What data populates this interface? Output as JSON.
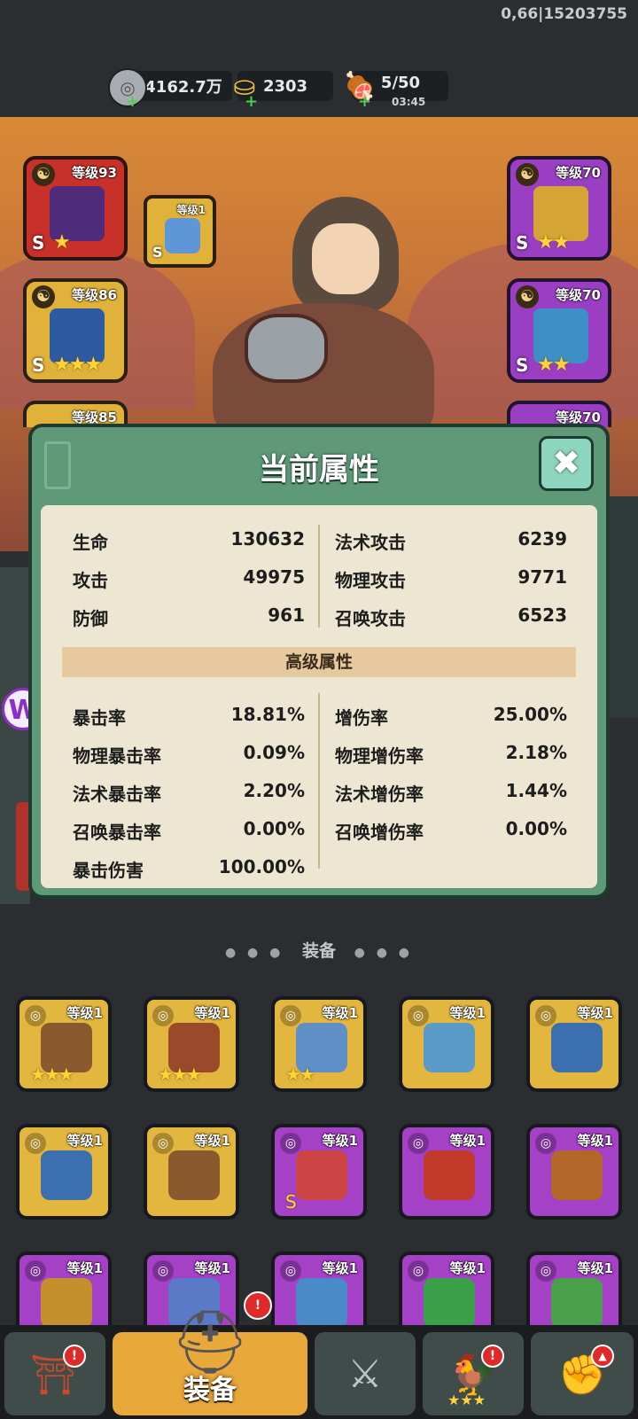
{
  "status": {
    "coords": "0,66|15203755"
  },
  "resources": {
    "silver": {
      "value": "4162.7万",
      "icon": "coin-icon"
    },
    "gold": {
      "value": "2303",
      "icon": "ingot-icon"
    },
    "stamina": {
      "value": "5/50",
      "timer": "03:45",
      "icon": "drumstick-icon"
    }
  },
  "slots_left": [
    {
      "level": "等级93",
      "grade": "S",
      "stars": "★",
      "color": "red"
    },
    {
      "level": "等级86",
      "grade": "S",
      "stars": "★★★",
      "color": "gold"
    },
    {
      "level": "等级85"
    }
  ],
  "slot_small": {
    "level": "等级1",
    "grade": "S"
  },
  "slots_right": [
    {
      "level": "等级70",
      "grade": "S",
      "stars": "★★",
      "color": "purple"
    },
    {
      "level": "等级70",
      "grade": "S",
      "stars": "★★",
      "color": "purple"
    },
    {
      "level": "等级70"
    }
  ],
  "modal": {
    "title": "当前属性",
    "close": "✖",
    "basic_left": [
      {
        "key": "生命",
        "value": "130632"
      },
      {
        "key": "攻击",
        "value": "49975"
      },
      {
        "key": "防御",
        "value": "961"
      }
    ],
    "basic_right": [
      {
        "key": "法术攻击",
        "value": "6239"
      },
      {
        "key": "物理攻击",
        "value": "9771"
      },
      {
        "key": "召唤攻击",
        "value": "6523"
      }
    ],
    "advanced_title": "高级属性",
    "adv_left": [
      {
        "key": "暴击率",
        "value": "18.81%"
      },
      {
        "key": "物理暴击率",
        "value": "0.09%"
      },
      {
        "key": "法术暴击率",
        "value": "2.20%"
      },
      {
        "key": "召唤暴击率",
        "value": "0.00%"
      },
      {
        "key": "暴击伤害",
        "value": "100.00%"
      }
    ],
    "adv_right": [
      {
        "key": "增伤率",
        "value": "25.00%"
      },
      {
        "key": "物理增伤率",
        "value": "2.18%"
      },
      {
        "key": "法术增伤率",
        "value": "1.44%"
      },
      {
        "key": "召唤增伤率",
        "value": "0.00%"
      }
    ]
  },
  "equip_section": {
    "label": "装备"
  },
  "equip_rows": [
    [
      {
        "level": "等级1",
        "color": "gold",
        "stars": "★★★"
      },
      {
        "level": "等级1",
        "color": "gold",
        "stars": "★★★"
      },
      {
        "level": "等级1",
        "color": "gold",
        "stars": "★★"
      },
      {
        "level": "等级1",
        "color": "gold",
        "stars": ""
      },
      {
        "level": "等级1",
        "color": "gold",
        "stars": ""
      }
    ],
    [
      {
        "level": "等级1",
        "color": "gold",
        "stars": ""
      },
      {
        "level": "等级1",
        "color": "gold",
        "stars": ""
      },
      {
        "level": "等级1",
        "color": "purple",
        "stars": "S"
      },
      {
        "level": "等级1",
        "color": "purple",
        "stars": ""
      },
      {
        "level": "等级1",
        "color": "purple",
        "stars": ""
      }
    ],
    [
      {
        "level": "等级1",
        "color": "purple",
        "stars": ""
      },
      {
        "level": "等级1",
        "color": "purple",
        "stars": ""
      },
      {
        "level": "等级1",
        "color": "purple",
        "stars": ""
      },
      {
        "level": "等级1",
        "color": "purple",
        "stars": ""
      },
      {
        "level": "等级1",
        "color": "purple",
        "stars": ""
      }
    ]
  ],
  "nav": {
    "active_label": "装备",
    "badge": "!"
  },
  "colors": {
    "modal_green": "#5e9a78",
    "panel": "#ece6d2",
    "gold_item": "#e2b63f",
    "purple_item": "#a441c6",
    "accent_orange": "#e9a83a"
  }
}
